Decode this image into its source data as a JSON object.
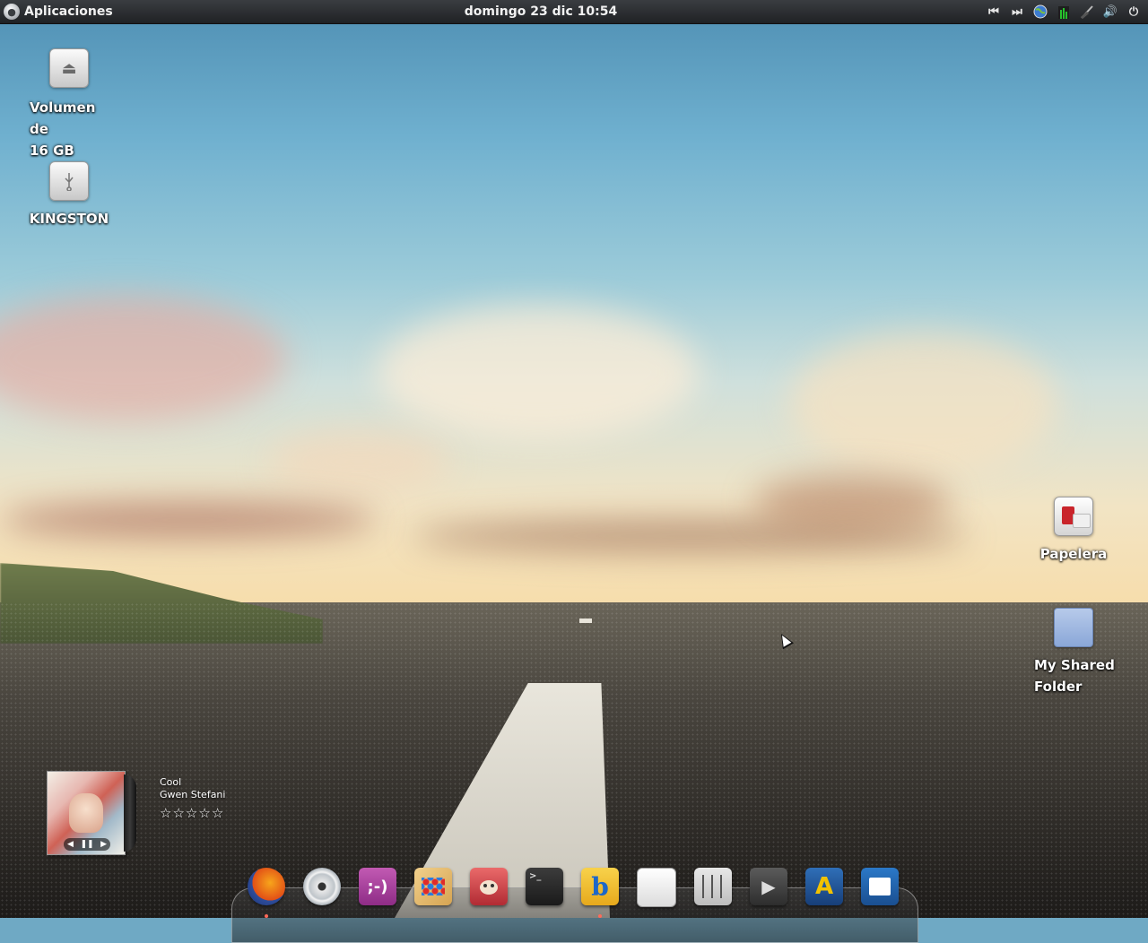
{
  "top_panel": {
    "apps_label": "Aplicaciones",
    "clock": "domingo 23 dic 10:54",
    "tray_icons": [
      "skip-back-icon",
      "skip-forward-icon",
      "network-globe-icon",
      "system-monitor-icon",
      "network-signal-icon",
      "volume-icon",
      "power-icon"
    ]
  },
  "desktop": {
    "icons": [
      {
        "label_line1": "Volumen de",
        "label_line2": "16 GB",
        "icon": "eject-drive-icon"
      },
      {
        "label": "KINGSTON",
        "icon": "usb-drive-icon"
      },
      {
        "label": "Papelera",
        "icon": "trash-icon"
      },
      {
        "label_line1": "My Shared",
        "label_line2": "Folder",
        "icon": "folder-icon"
      }
    ]
  },
  "music_widget": {
    "title": "Cool",
    "artist": "Gwen Stefani",
    "rating": 0,
    "controls": {
      "prev": "◀",
      "pause": "❚❚",
      "next": "▶"
    },
    "stars": [
      "☆",
      "☆",
      "☆",
      "☆",
      "☆"
    ]
  },
  "dock": {
    "items": [
      {
        "name": "firefox-icon",
        "running": true
      },
      {
        "name": "cd-burner-icon",
        "running": false
      },
      {
        "name": "chat-messenger-icon",
        "glyph": ";-)",
        "running": false
      },
      {
        "name": "paint-icon",
        "running": false
      },
      {
        "name": "gimp-icon",
        "running": false
      },
      {
        "name": "terminal-icon",
        "glyph": ">_",
        "running": false
      },
      {
        "name": "bluefish-editor-icon",
        "glyph": "b",
        "running": true
      },
      {
        "name": "text-document-icon",
        "running": false
      },
      {
        "name": "mixer-icon",
        "running": false
      },
      {
        "name": "video-editor-icon",
        "glyph": "▶",
        "running": false
      },
      {
        "name": "app-a-icon",
        "glyph": "A",
        "running": false
      },
      {
        "name": "writer-document-icon",
        "running": false
      }
    ]
  },
  "colors": {
    "panel": "#2a2c30",
    "sky_top": "#4f8fb3",
    "horizon": "#f7dca8",
    "road": "#2f2c28"
  }
}
